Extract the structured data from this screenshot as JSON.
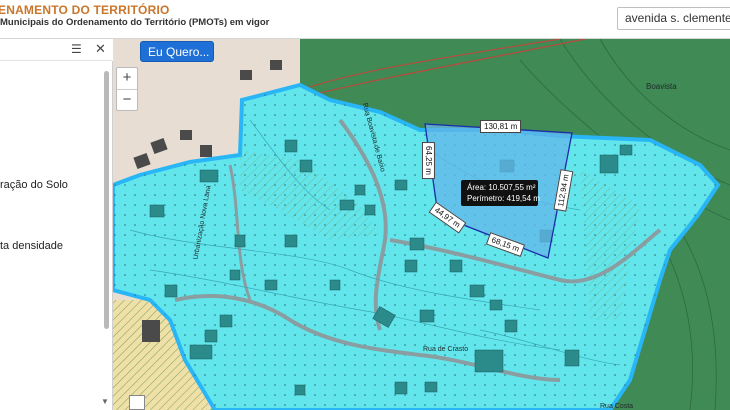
{
  "header": {
    "title_line1": "ENAMENTO DO TERRITÓRIO",
    "title_line2": "Municipais do Ordenamento do Território (PMOTs) em vigor",
    "search_value": "avenida s. clemente"
  },
  "panel": {
    "items": [
      "ração do Solo",
      "ta densidade"
    ]
  },
  "map": {
    "button_label": "Eu Quero...",
    "zoom_in": "+",
    "zoom_out": "−",
    "measurements": [
      "130,81 m",
      "64,25 m",
      "112,94 m",
      "44,97 m",
      "68,15 m"
    ],
    "area_label": "Área: 10.507,55 m²",
    "perimeter_label": "Perímetro: 419,54 m",
    "street_labels": [
      "Rua de Crasto",
      "Rua Boavista de Baixo",
      "Urbanização Nova Lana",
      "Rua Costa"
    ],
    "place_labels": [
      "Boavista"
    ]
  },
  "colors": {
    "zone_fill": "#62e6ec",
    "zone_border": "#29b6f6",
    "forest": "#3f8a55",
    "green_area": "#67c33b",
    "parcel_fill": "#64b6e8",
    "parcel_border": "#1a2da8"
  }
}
